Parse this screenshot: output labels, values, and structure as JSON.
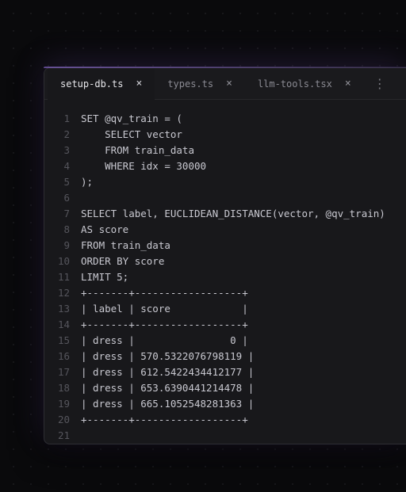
{
  "tabs": [
    {
      "label": "setup-db.ts",
      "active": true
    },
    {
      "label": "types.ts",
      "active": false
    },
    {
      "label": "llm-tools.tsx",
      "active": false
    }
  ],
  "overflow_glyph": "⋮",
  "close_glyph": "×",
  "code_lines": [
    "SET @qv_train = (",
    "    SELECT vector",
    "    FROM train_data",
    "    WHERE idx = 30000",
    ");",
    "",
    "SELECT label, EUCLIDEAN_DISTANCE(vector, @qv_train)",
    "AS score",
    "FROM train_data",
    "ORDER BY score",
    "LIMIT 5;",
    "+-------+------------------+",
    "| label | score            |",
    "+-------+------------------+",
    "| dress |                0 |",
    "| dress | 570.5322076798119 |",
    "| dress | 612.5422434412177 |",
    "| dress | 653.6390441214478 |",
    "| dress | 665.1052548281363 |",
    "+-------+------------------+",
    "",
    ""
  ],
  "result_table": {
    "columns": [
      "label",
      "score"
    ],
    "rows": [
      [
        "dress",
        0
      ],
      [
        "dress",
        570.5322076798119
      ],
      [
        "dress",
        612.5422434412177
      ],
      [
        "dress",
        653.6390441214478
      ],
      [
        "dress",
        665.1052548281363
      ]
    ]
  }
}
